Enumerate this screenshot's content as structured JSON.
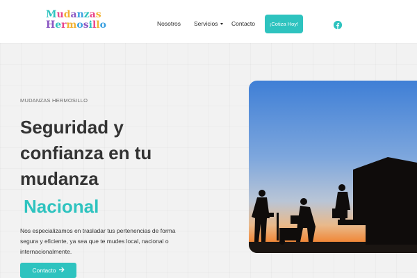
{
  "brand": {
    "line1": "Mudanzas",
    "line2": "Hermosillo",
    "colors": [
      "#2ec3bf",
      "#e8458b",
      "#f2b233",
      "#8a56c2",
      "#3aa0e0"
    ]
  },
  "nav": {
    "items": [
      "Nosotros",
      "Servicios",
      "Contacto"
    ],
    "cta": "¡Cotiza Hoy!",
    "social_icon": "facebook-icon"
  },
  "hero": {
    "eyebrow": "MUDANZAS HERMOSILLO",
    "headline_lines": [
      "Seguridad y",
      "confianza en tu",
      "mudanza"
    ],
    "accent_word": "Nacional",
    "description": "Nos especializamos en trasladar tus pertenencias de forma segura y eficiente, ya sea que te mudes local, nacional o internacionalmente.",
    "button_label": "Contacto",
    "button_icon": "arrow-right-icon"
  },
  "theme": {
    "accent": "#2ec3bf",
    "text_dark": "#333333"
  }
}
